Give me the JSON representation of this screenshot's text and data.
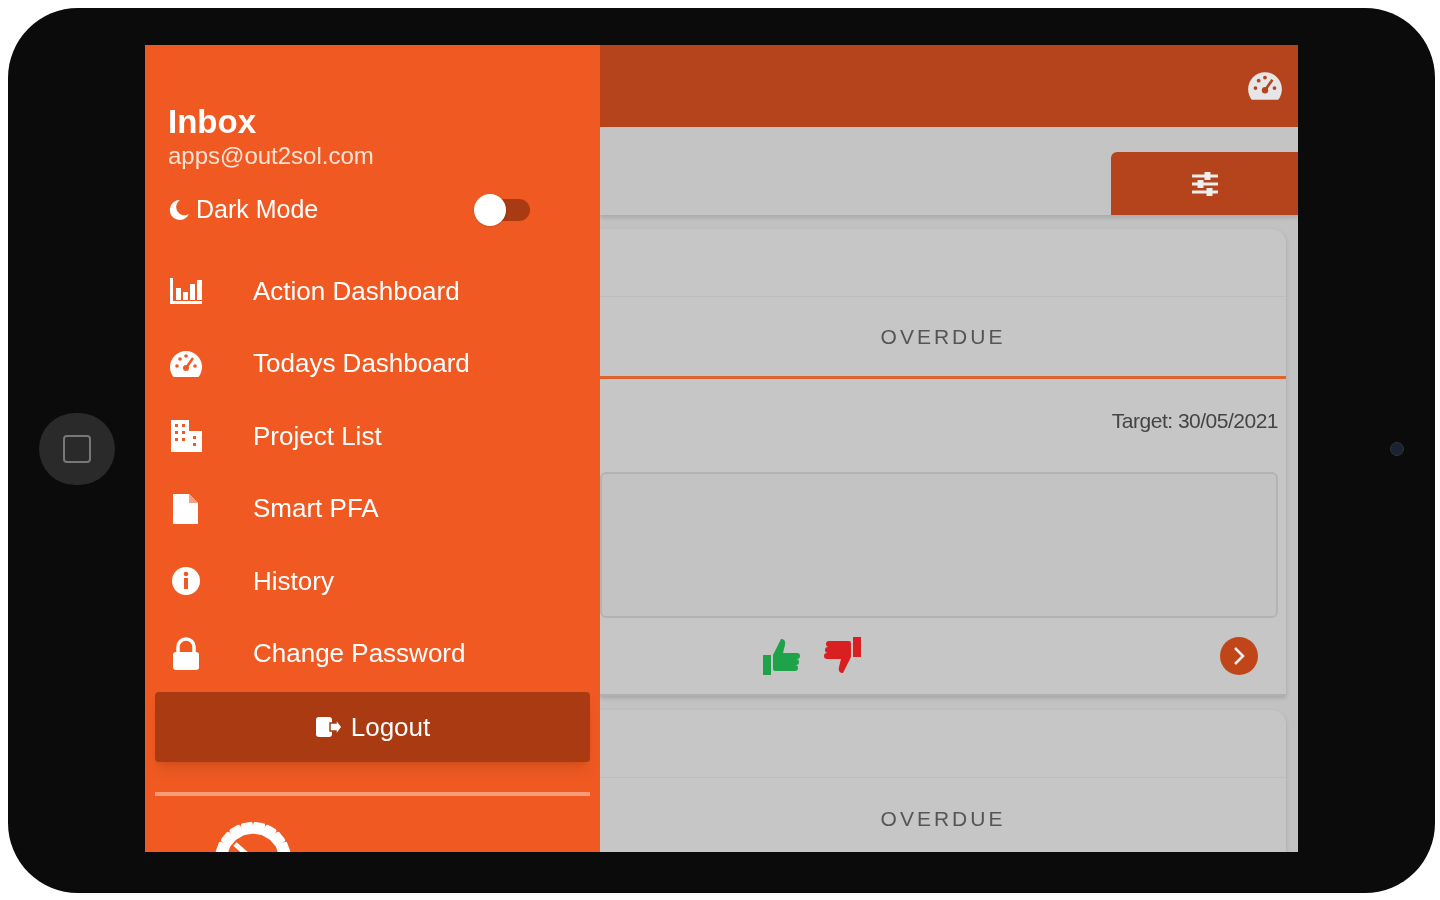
{
  "drawer": {
    "title": "Inbox",
    "email": "apps@out2sol.com",
    "dark_mode": {
      "label": "Dark Mode",
      "on": false
    },
    "items": [
      {
        "label": "Action Dashboard"
      },
      {
        "label": "Todays Dashboard"
      },
      {
        "label": "Project List"
      },
      {
        "label": "Smart PFA"
      },
      {
        "label": "History"
      },
      {
        "label": "Change Password"
      }
    ],
    "logout": "Logout"
  },
  "cards": [
    {
      "status": "OVERDUE",
      "target": "Target: 30/05/2021",
      "kind": "full"
    },
    {
      "status": "OVERDUE",
      "kind": "cut"
    }
  ]
}
